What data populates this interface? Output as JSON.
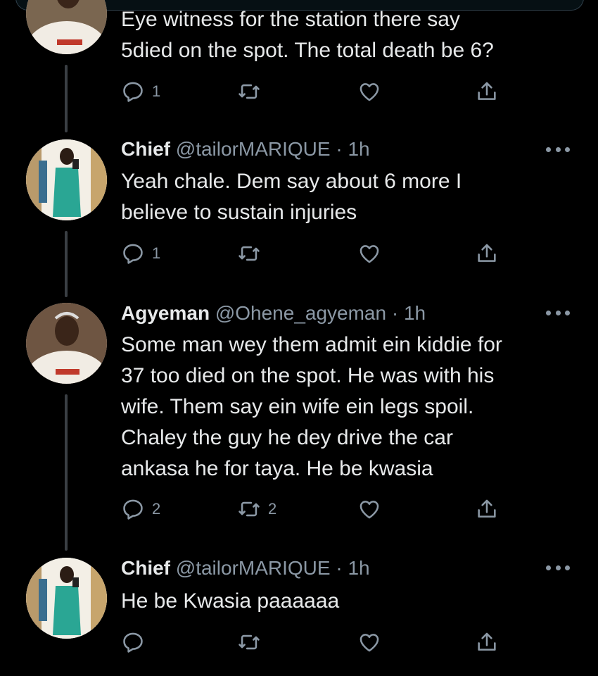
{
  "tweets": [
    {
      "name": "",
      "handle": "",
      "time": "",
      "text": "Eye witness for the station there say\n5died on the spot. The total death be 6?",
      "avatar_icon": "avatar-person-white-shirt",
      "replies": "1",
      "retweets": "",
      "likes": ""
    },
    {
      "name": "Chief",
      "handle": "@tailorMARIQUE",
      "time": "· 1h",
      "text": "Yeah chale. Dem say about 6 more I\nbelieve to sustain injuries",
      "avatar_icon": "avatar-person-green-outfit",
      "replies": "1",
      "retweets": "",
      "likes": ""
    },
    {
      "name": "Agyeman",
      "handle": "@Ohene_agyeman",
      "time": "· 1h",
      "text": "Some man wey them admit ein kiddie for\n37 too died on the spot. He was with his\nwife. Them say ein wife ein legs spoil.\nChaley the guy he dey drive the car\nankasa he for taya. He be kwasia",
      "avatar_icon": "avatar-person-white-shirt",
      "replies": "2",
      "retweets": "2",
      "likes": ""
    },
    {
      "name": "Chief",
      "handle": "@tailorMARIQUE",
      "time": "· 1h",
      "text": "He be Kwasia paaaaaa",
      "avatar_icon": "avatar-person-green-outfit",
      "replies": "",
      "retweets": "",
      "likes": ""
    }
  ],
  "colors": {
    "background": "#000000",
    "text": "#e7e9ea",
    "muted": "#8b98a5",
    "thread_line": "#3a3f44"
  },
  "icons": [
    "reply-icon",
    "retweet-icon",
    "like-icon",
    "share-icon",
    "more-icon"
  ]
}
